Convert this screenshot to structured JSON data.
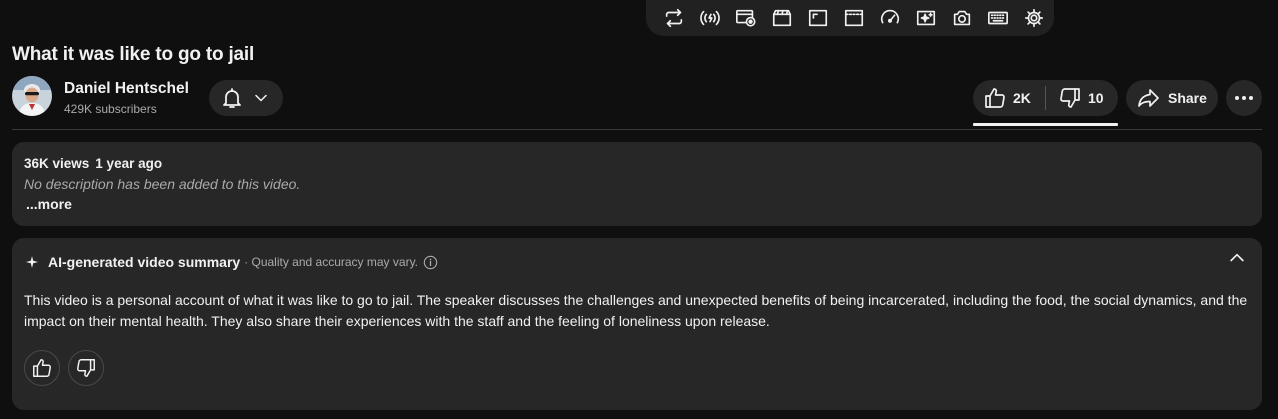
{
  "toolbar": {
    "icons": [
      "repeat-icon",
      "broadcast-icon",
      "watch-later-icon",
      "clapperboard-icon",
      "aspect-ratio-icon",
      "cinema-mode-icon",
      "speed-gauge-icon",
      "sparkle-screen-icon",
      "screenshot-icon",
      "keyboard-icon",
      "settings-icon"
    ]
  },
  "video": {
    "title": "What it was like to go to jail"
  },
  "channel": {
    "name": "Daniel Hentschel",
    "subscribers": "429K subscribers"
  },
  "actions": {
    "likes": "2K",
    "dislikes": "10",
    "share_label": "Share"
  },
  "description": {
    "views": "36K views",
    "age": "1 year ago",
    "text": "No description has been added to this video.",
    "more_label": "...more"
  },
  "ai_summary": {
    "title": "AI-generated video summary",
    "note": "· Quality and accuracy may vary.",
    "text": "This video is a personal account of what it was like to go to jail. The speaker discusses the challenges and unexpected benefits of being incarcerated, including the food, the social dynamics, and the impact on their mental health. They also share their experiences with the staff and the feeling of loneliness upon release."
  },
  "colors": {
    "background": "#0f0f0f",
    "surface": "#272727",
    "text": "#f1f1f1",
    "secondary_text": "#aaaaaa"
  }
}
